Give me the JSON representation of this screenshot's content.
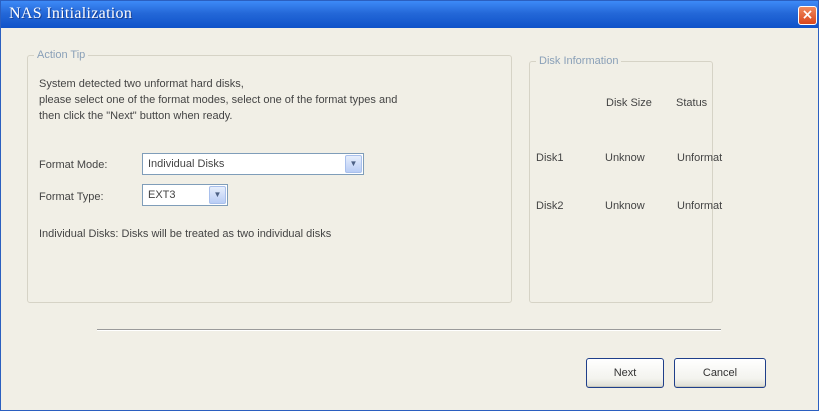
{
  "window": {
    "title": "NAS Initialization",
    "close_label": "×"
  },
  "action_tip": {
    "legend": "Action Tip",
    "lines": [
      "System detected two unformat hard disks,",
      "please select one of the format modes, select one of the format types  and",
      "then click the \"Next\" button when ready."
    ],
    "format_mode_label": "Format Mode:",
    "format_mode_value": "Individual Disks",
    "format_type_label": "Format Type:",
    "format_type_value": "EXT3",
    "description": "Individual Disks: Disks will be treated as two individual disks"
  },
  "disk_info": {
    "legend": "Disk Information",
    "headers": [
      "",
      "Disk Size",
      "Status"
    ],
    "rows": [
      {
        "name": "Disk1",
        "size": "Unknow",
        "status": "Unformat"
      },
      {
        "name": "Disk2",
        "size": "Unknow",
        "status": "Unformat"
      }
    ]
  },
  "buttons": {
    "next": "Next",
    "cancel": "Cancel"
  },
  "icons": {
    "dropdown": "chevron-down-icon",
    "close": "close-icon"
  }
}
